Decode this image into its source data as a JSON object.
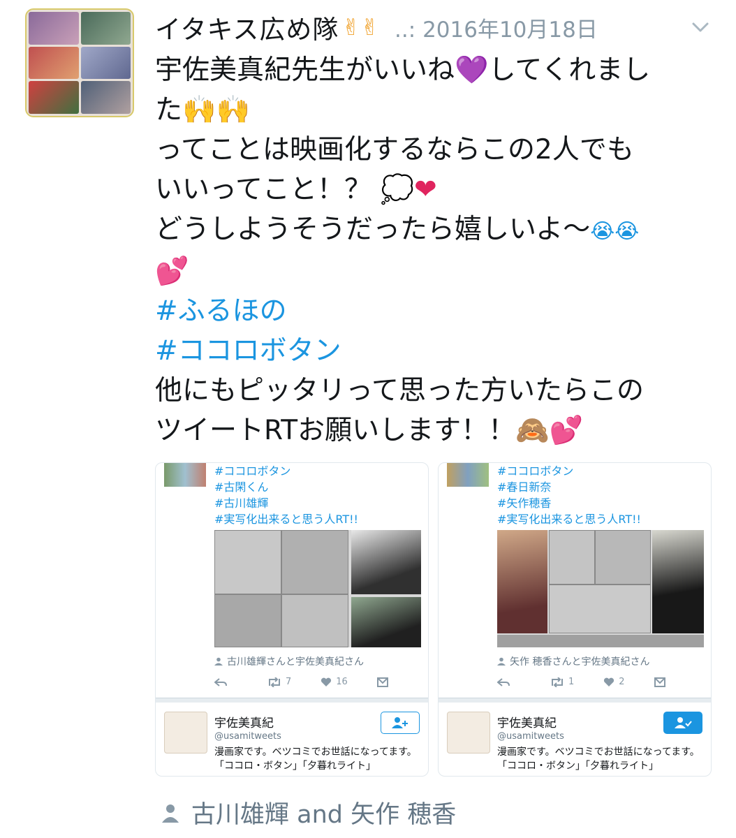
{
  "tweet": {
    "author_name": "イタキス広め隊",
    "author_emoji": "✌✌",
    "timestamp_prefix": "..: ",
    "timestamp": "2016年10月18日",
    "lines": [
      {
        "text": "宇佐美真紀先生がいいね",
        "emoji": "💜",
        "emoji2": "",
        "rest": "してくれまし"
      },
      {
        "text": "た",
        "emoji": "🙌🙌",
        "emoji2": "",
        "rest": ""
      },
      {
        "text": "ってことは映画化するならこの2人でも",
        "emoji": "",
        "emoji2": "",
        "rest": ""
      },
      {
        "text": "いいってこと！？",
        "emoji": "💭",
        "emoji2": "❤",
        "rest": ""
      },
      {
        "text": "どうしようそうだったら嬉しいよ〜",
        "emoji": "😭😭",
        "emoji2": "",
        "rest": ""
      },
      {
        "text": "",
        "emoji": "",
        "emoji2": "💕",
        "rest": ""
      }
    ],
    "hashtags": [
      "#ふるほの",
      "#ココロボタン"
    ],
    "outro_lines": [
      "他にもピッタリって思った方いたらこの",
      "ツイートRTお願いします！！"
    ],
    "outro_emoji": "🙈💕"
  },
  "cards": [
    {
      "hashtags": [
        "#ココロボタン",
        "#古閑くん",
        "#古川雄輝",
        "#実写化出来ると思う人RT!!"
      ],
      "tagged": "古川雄輝さんと宇佐美真紀さん",
      "retweets": "7",
      "likes": "16",
      "profile_name": "宇佐美真紀",
      "profile_handle": "@usamitweets",
      "profile_bio": "漫画家です。ベツコミでお世話になってます。「ココロ・ボタン」「夕暮れライト」",
      "follow_state": "follow"
    },
    {
      "hashtags": [
        "#ココロボタン",
        "#春日新奈",
        "#矢作穂香",
        "#実写化出来ると思う人RT!!"
      ],
      "tagged": "矢作 穂香さんと宇佐美真紀さん",
      "retweets": "1",
      "likes": "2",
      "profile_name": "宇佐美真紀",
      "profile_handle": "@usamitweets",
      "profile_bio": "漫画家です。ベツコミでお世話になってます。「ココロ・ボタン」「夕暮れライト」",
      "follow_state": "following"
    }
  ],
  "context": {
    "person1": "古川雄輝",
    "joiner": "and",
    "person2": "矢作 穂香"
  },
  "colors": {
    "link": "#1b95e0",
    "muted": "#657786",
    "heart": "#e0245e"
  },
  "icons": [
    "chevron-down-icon",
    "person-icon",
    "reply-icon",
    "retweet-icon",
    "heart-icon",
    "dm-icon",
    "add-user-icon",
    "following-icon"
  ]
}
